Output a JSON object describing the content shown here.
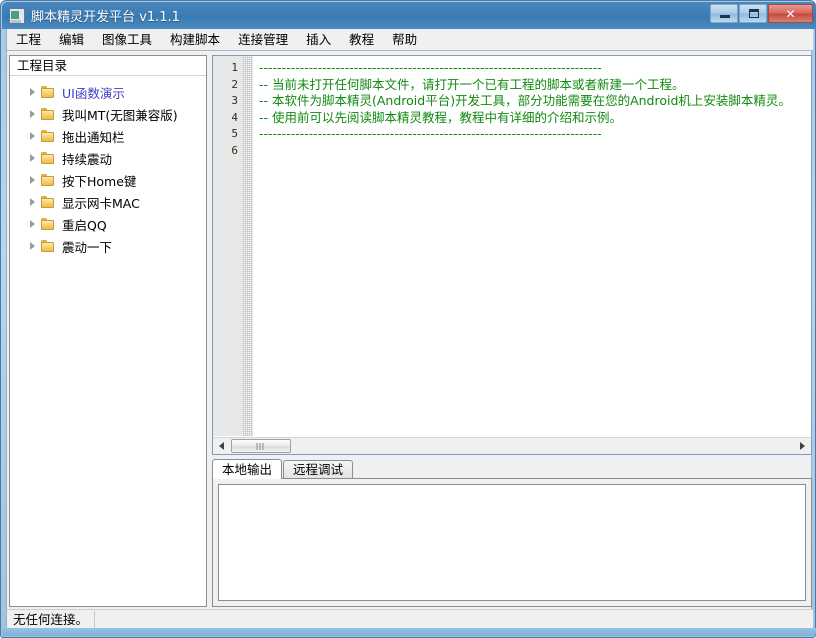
{
  "window": {
    "title": "脚本精灵开发平台 v1.1.1",
    "app_icon": "application-window-icon",
    "caption": {
      "minimize_label": "",
      "maximize_label": "",
      "close_label": "✕"
    }
  },
  "menubar": {
    "items": [
      {
        "label": "工程",
        "name": "menu-project"
      },
      {
        "label": "编辑",
        "name": "menu-edit"
      },
      {
        "label": "图像工具",
        "name": "menu-image-tools"
      },
      {
        "label": "构建脚本",
        "name": "menu-build-script"
      },
      {
        "label": "连接管理",
        "name": "menu-connection-manager"
      },
      {
        "label": "插入",
        "name": "menu-insert"
      },
      {
        "label": "教程",
        "name": "menu-tutorial"
      },
      {
        "label": "帮助",
        "name": "menu-help"
      }
    ]
  },
  "sidebar": {
    "header": "工程目录",
    "items": [
      {
        "label": "UI函数演示",
        "selected": true
      },
      {
        "label": "我叫MT(无图兼容版)",
        "selected": false
      },
      {
        "label": "拖出通知栏",
        "selected": false
      },
      {
        "label": "持续震动",
        "selected": false
      },
      {
        "label": "按下Home键",
        "selected": false
      },
      {
        "label": "显示网卡MAC",
        "selected": false
      },
      {
        "label": "重启QQ",
        "selected": false
      },
      {
        "label": "震动一下",
        "selected": false
      }
    ]
  },
  "editor": {
    "line_numbers": [
      "1",
      "2",
      "3",
      "4",
      "5",
      "6"
    ],
    "lines": [
      "----------------------------------------------------------------------------",
      "-- 当前未打开任何脚本文件，请打开一个已有工程的脚本或者新建一个工程。",
      "-- 本软件为脚本精灵(Android平台)开发工具，部分功能需要在您的Android机上安装脚本精灵。",
      "-- 使用前可以先阅读脚本精灵教程，教程中有详细的介绍和示例。",
      "----------------------------------------------------------------------------",
      ""
    ],
    "comment_color": "#128a12"
  },
  "output": {
    "tabs": [
      {
        "label": "本地输出",
        "active": true
      },
      {
        "label": "远程调试",
        "active": false
      }
    ],
    "content": ""
  },
  "statusbar": {
    "message": "无任何连接。"
  },
  "colors": {
    "titlebar": "#3d7cb4",
    "accent": "#4040c0",
    "comment_green": "#128a12"
  }
}
